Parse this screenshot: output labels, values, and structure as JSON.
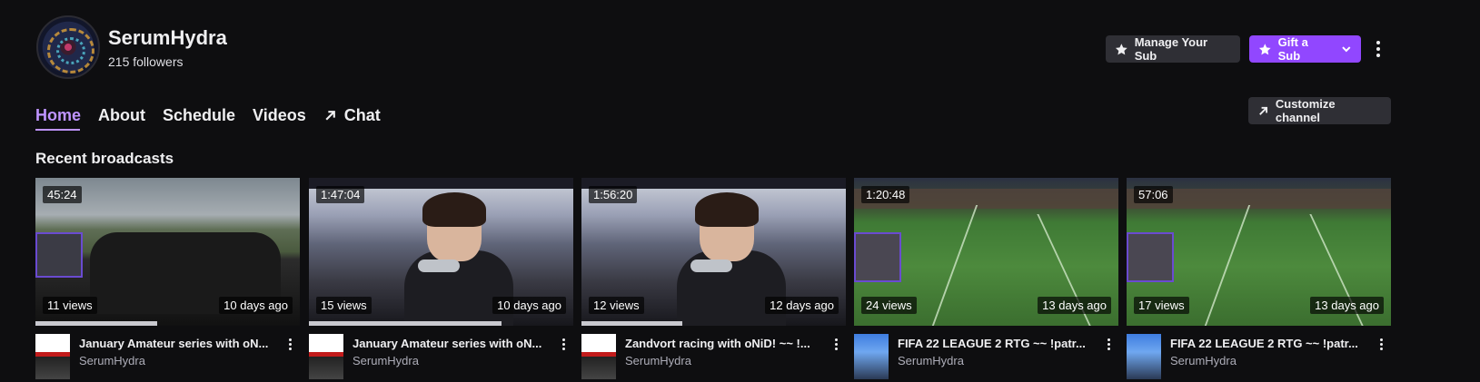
{
  "channel": {
    "name": "SerumHydra",
    "followers": "215 followers"
  },
  "buttons": {
    "manage_sub": "Manage Your Sub",
    "gift_sub": "Gift a Sub",
    "customize": "Customize channel"
  },
  "nav": {
    "tabs": [
      {
        "label": "Home",
        "active": true
      },
      {
        "label": "About"
      },
      {
        "label": "Schedule"
      },
      {
        "label": "Videos"
      },
      {
        "label": "Chat"
      }
    ]
  },
  "section": {
    "title": "Recent broadcasts"
  },
  "videos": [
    {
      "duration": "45:24",
      "views": "11 views",
      "date": "10 days ago",
      "title": "January Amateur series with oN...",
      "author": "SerumHydra",
      "progress": 0.46,
      "thumb": "race",
      "game": "acc"
    },
    {
      "duration": "1:47:04",
      "views": "15 views",
      "date": "10 days ago",
      "title": "January Amateur series with oN...",
      "author": "SerumHydra",
      "progress": 0.73,
      "thumb": "room",
      "game": "acc"
    },
    {
      "duration": "1:56:20",
      "views": "12 views",
      "date": "12 days ago",
      "title": "Zandvort racing with oNiD! ~~ !...",
      "author": "SerumHydra",
      "progress": 0.38,
      "thumb": "room",
      "game": "acc"
    },
    {
      "duration": "1:20:48",
      "views": "24 views",
      "date": "13 days ago",
      "title": "FIFA 22 LEAGUE 2 RTG ~~ !patr...",
      "author": "SerumHydra",
      "progress": 0,
      "thumb": "fifa",
      "game": "fifa"
    },
    {
      "duration": "57:06",
      "views": "17 views",
      "date": "13 days ago",
      "title": "FIFA 22 LEAGUE 2 RTG ~~ !patr...",
      "author": "SerumHydra",
      "progress": 0,
      "thumb": "fifa",
      "game": "fifa"
    }
  ],
  "colors": {
    "background": "#0e0e10",
    "accent": "#9147ff",
    "active_tab": "#bf94ff"
  }
}
